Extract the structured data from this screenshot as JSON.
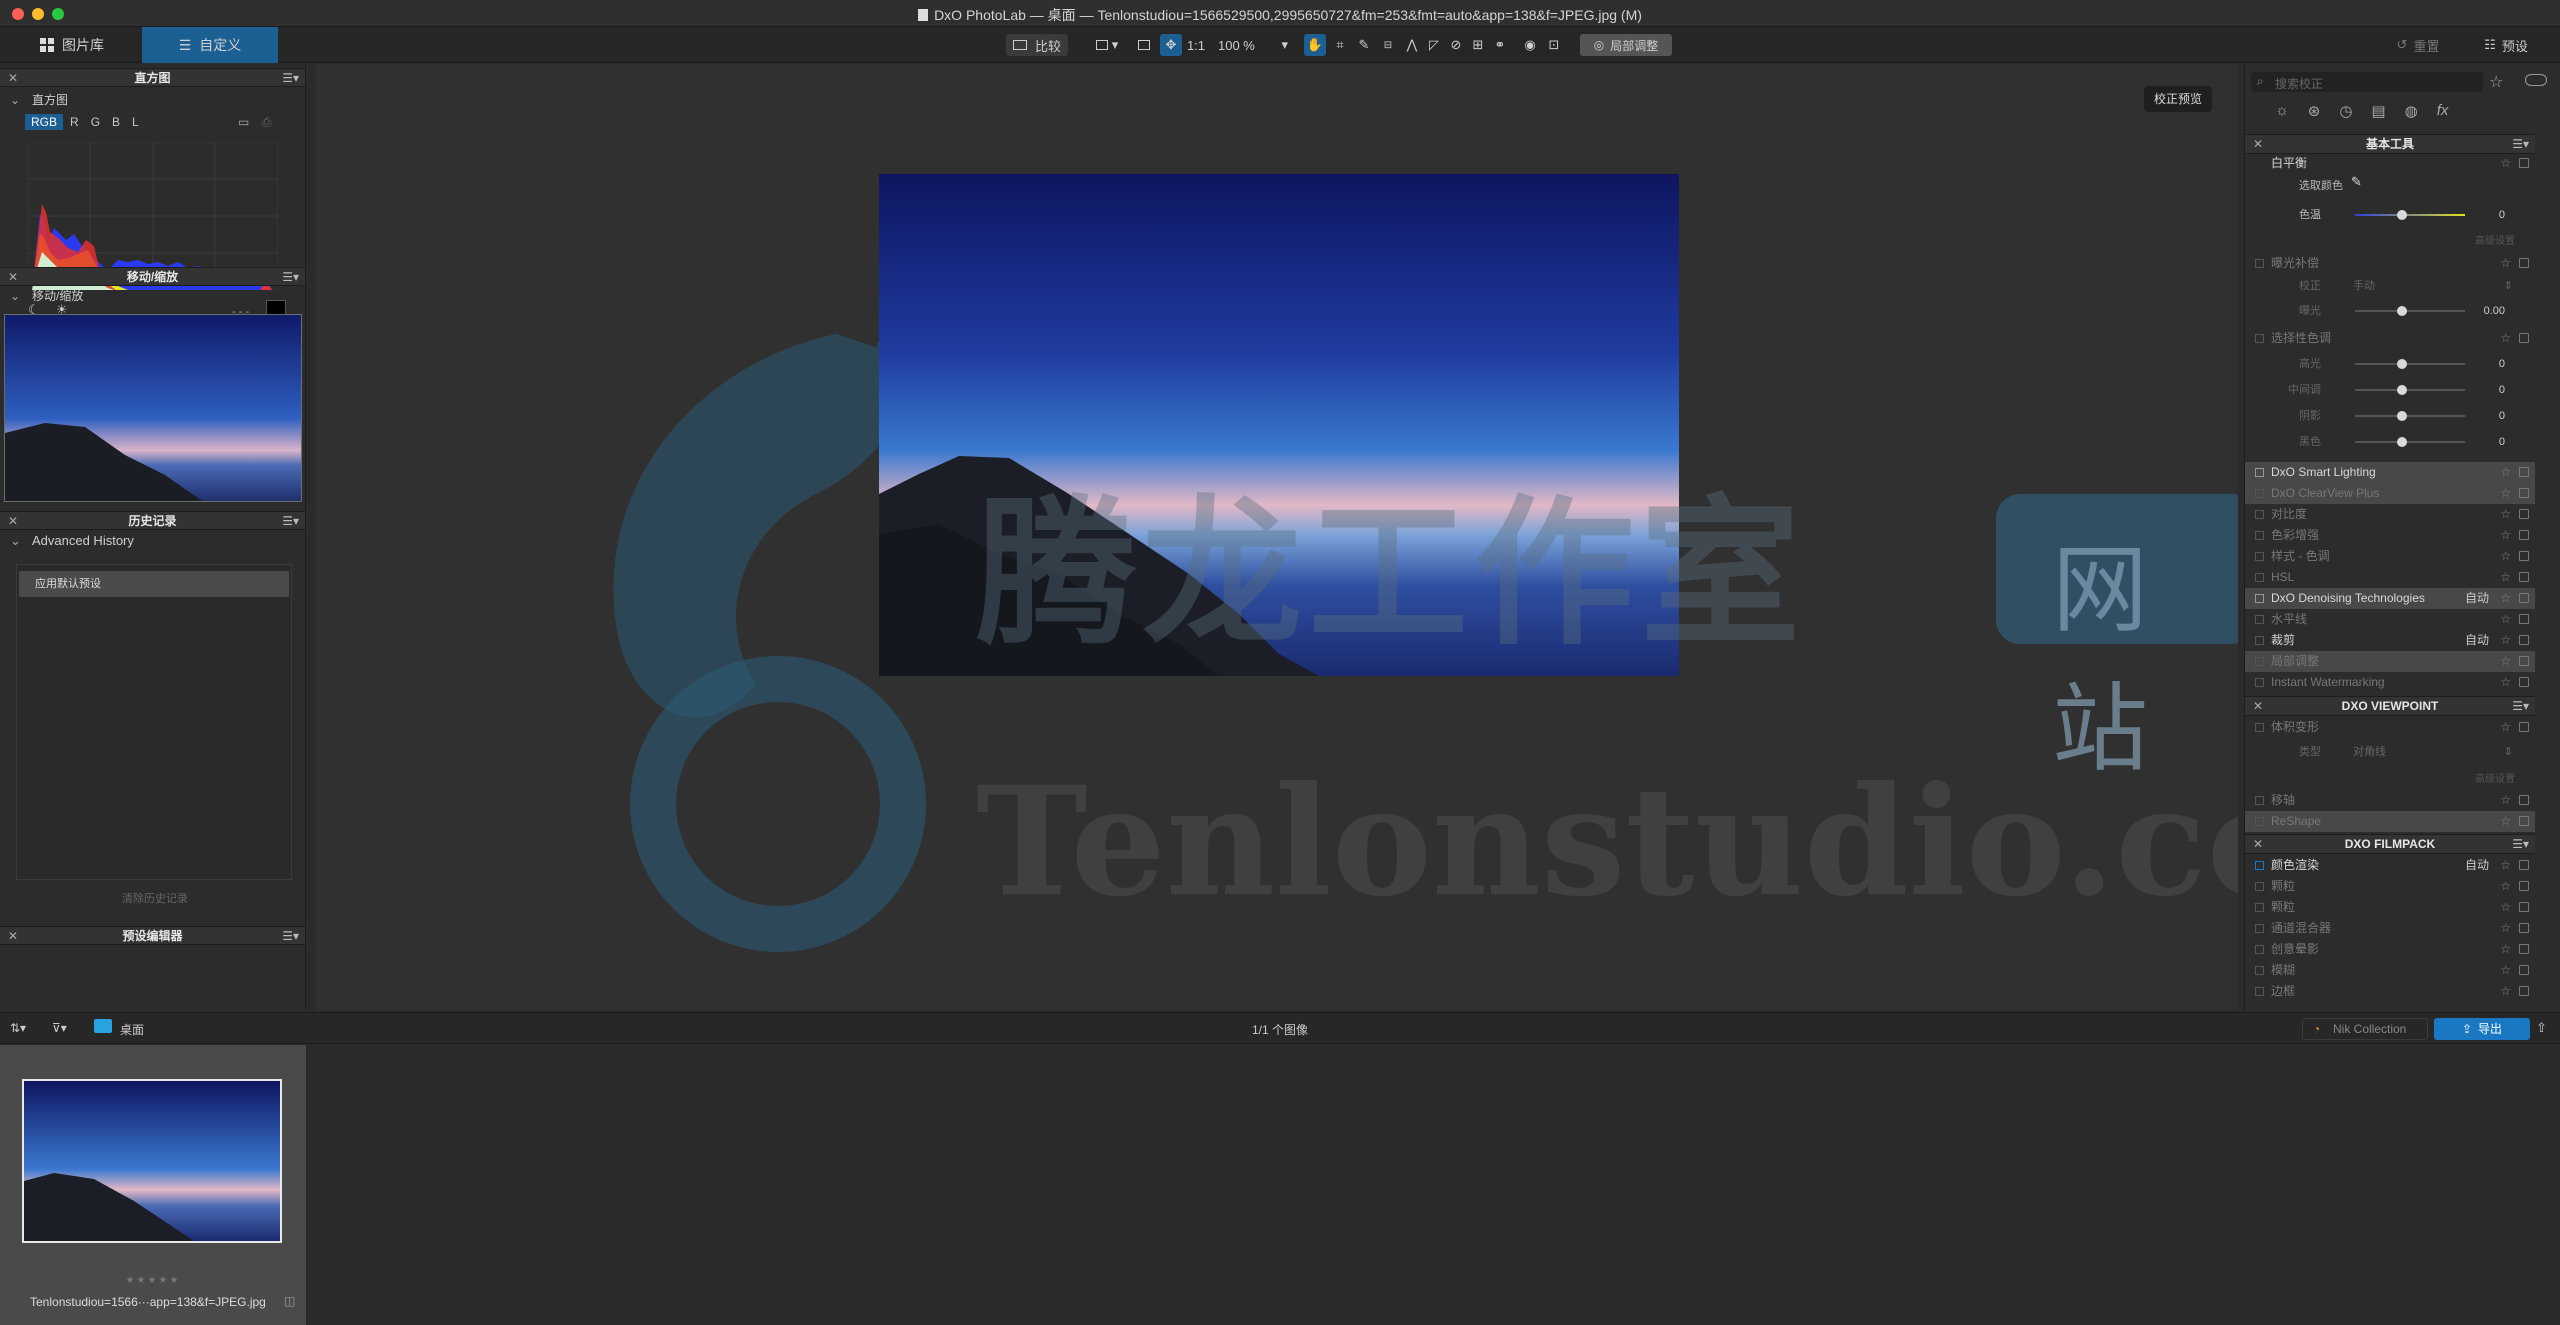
{
  "window": {
    "title": "DxO PhotoLab — 桌面 — Tenlonstudiou=1566529500,2995650727&fm=253&fmt=auto&app=138&f=JPEG.jpg (M)"
  },
  "toolbar": {
    "tab_library": "图片库",
    "tab_customize": "自定义",
    "compare": "比较",
    "one_to_one": "1:1",
    "zoom": "100 %",
    "local_adjust": "局部调整",
    "reset": "重置",
    "preset": "预设"
  },
  "left": {
    "histogram_panel": "直方图",
    "histogram_sub": "直方图",
    "channels": [
      "RGB",
      "R",
      "G",
      "B",
      "L"
    ],
    "histogram_readout": "-,-,-",
    "move_zoom_panel": "移动/缩放",
    "move_zoom_sub": "移动/缩放",
    "history_panel": "历史记录",
    "history_sub": "Advanced History",
    "history_items": [
      "应用默认预设"
    ],
    "clear_history": "清除历史记录",
    "preset_editor": "预设编辑器"
  },
  "viewer": {
    "preview_button": "校正预览",
    "watermark_cn": "腾龙工作室",
    "watermark_site": "网站",
    "watermark_en": "Tenlonstudio.com"
  },
  "right": {
    "search_placeholder": "搜索校正",
    "basic_tools": "基本工具",
    "white_balance": "白平衡",
    "pick_color": "选取颜色",
    "temperature": "色温",
    "temperature_val": "0",
    "advanced1": "高级设置",
    "exposure": "曝光补偿",
    "correction": "校正",
    "correction_val": "手动",
    "exposure_lbl": "曝光",
    "exposure_val": "0.00",
    "selective_tone": "选择性色调",
    "highlights": "高光",
    "midtones": "中间调",
    "shadows": "阴影",
    "blacks": "黑色",
    "tone_val": "0",
    "smart_lighting": "DxO Smart Lighting",
    "clearview": "DxO ClearView Plus",
    "contrast": "对比度",
    "color_accent": "色彩增强",
    "style_tone": "样式 - 色调",
    "hsl": "HSL",
    "denoising": "DxO Denoising Technologies",
    "auto": "自动",
    "horizon": "水平线",
    "crop": "裁剪",
    "local_adj": "局部调整",
    "watermark": "Instant Watermarking",
    "viewpoint": "DXO VIEWPOINT",
    "volume_deform": "体积变形",
    "type": "类型",
    "type_val": "对角线",
    "advanced2": "高级设置",
    "shift": "移轴",
    "reshape": "ReShape",
    "filmpack": "DXO FILMPACK",
    "color_render": "颜色渲染",
    "grain": "颗粒",
    "fine": "颗粒",
    "channel_mixer": "通道混合器",
    "creative_vignette": "创意晕影",
    "blur": "模糊",
    "frame": "边框"
  },
  "bottom": {
    "folder": "桌面",
    "count": "1/1 个图像",
    "nik": "Nik Collection",
    "export": "导出",
    "thumb_name": "Tenlonstudiou=1566···app=138&f=JPEG.jpg",
    "stars": "★★★★★"
  },
  "colors": {
    "accent": "#1b6ea8",
    "export": "#1a78c2"
  }
}
